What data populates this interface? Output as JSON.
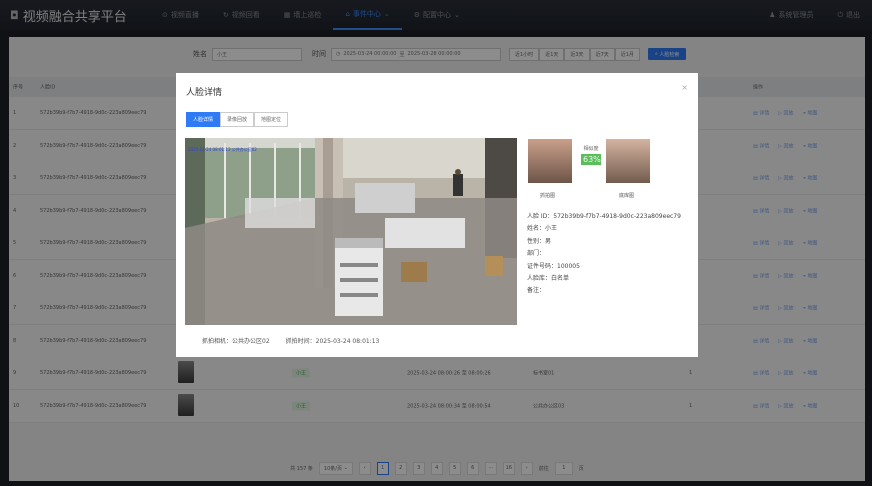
{
  "app": {
    "title": "视频融合共享平台"
  },
  "nav": {
    "items": [
      {
        "label": "视频直播",
        "icon": "play-circle-icon"
      },
      {
        "label": "视频回看",
        "icon": "replay-icon"
      },
      {
        "label": "墙上巡检",
        "icon": "building-icon"
      },
      {
        "label": "事件中心",
        "icon": "bell-icon",
        "active": true
      },
      {
        "label": "配置中心",
        "icon": "gear-icon"
      }
    ],
    "user": "系统管理员",
    "logout": "退出"
  },
  "search": {
    "name_label": "姓名",
    "name_value": "小王",
    "time_label": "时间",
    "time_start": "2025-03-24 00:00:00",
    "time_sep": "至",
    "time_end": "2025-03-28 00:00:00",
    "quick": [
      "近1小时",
      "近1天",
      "近3天",
      "近7天",
      "近1月"
    ],
    "search_button": "人脸检索"
  },
  "table": {
    "headers": [
      "序号",
      "人脸ID",
      "",
      "操作"
    ],
    "actions": [
      "详情",
      "回放",
      "地图"
    ],
    "rows": [
      {
        "no": "1",
        "face_id": "572b39b9-f7b7-4918-9d0c-223a809eec79"
      },
      {
        "no": "2",
        "face_id": "572b39b9-f7b7-4918-9d0c-223a809eec79"
      },
      {
        "no": "3",
        "face_id": "572b39b9-f7b7-4918-9d0c-223a809eec79"
      },
      {
        "no": "4",
        "face_id": "572b39b9-f7b7-4918-9d0c-223a809eec79"
      },
      {
        "no": "5",
        "face_id": "572b39b9-f7b7-4918-9d0c-223a809eec79"
      },
      {
        "no": "6",
        "face_id": "572b39b9-f7b7-4918-9d0c-223a809eec79"
      },
      {
        "no": "7",
        "face_id": "572b39b9-f7b7-4918-9d0c-223a809eec79"
      },
      {
        "no": "8",
        "face_id": "572b39b9-f7b7-4918-9d0c-223a809eec79"
      },
      {
        "no": "9",
        "face_id": "572b39b9-f7b7-4918-9d0c-223a809eec79",
        "name": "小王",
        "time": "2025-03-24 08:00:26 至 08:00:26",
        "camera": "标书室01",
        "count": "1"
      },
      {
        "no": "10",
        "face_id": "572b39b9-f7b7-4918-9d0c-223a809eec79",
        "name": "小王",
        "time": "2025-03-24 08:00:34 至 08:00:54",
        "camera": "公共办公区03",
        "count": "1"
      }
    ]
  },
  "pager": {
    "total": "共 157 条",
    "page_size": "10条/页",
    "prev": "‹",
    "pages": [
      "1",
      "2",
      "3",
      "4",
      "5",
      "6",
      "···",
      "16"
    ],
    "next": "›",
    "goto_label": "前往",
    "goto_value": "1",
    "goto_suffix": "页"
  },
  "modal": {
    "title": "人脸详情",
    "close": "×",
    "tabs": [
      "人脸详情",
      "录像回放",
      "地图定位"
    ],
    "overlay_text": "2025-03-24 08:01:13  公共办公区02",
    "capture_label": "抓拍图",
    "library_label": "底库图",
    "similarity_label": "相似度",
    "similarity_value": "63%",
    "info": {
      "face_id": "人脸 ID：572b39b9-f7b7-4918-9d0c-223a809eec79",
      "name": "姓名：小王",
      "gender": "性别：男",
      "dept": "部门：",
      "id_no": "证件号码：100005",
      "library": "人脸库：白名单",
      "remark": "备注："
    },
    "footer": {
      "camera": "抓拍相机：公共办公区02",
      "time": "抓拍时间：2025-03-24 08:01:13"
    }
  }
}
